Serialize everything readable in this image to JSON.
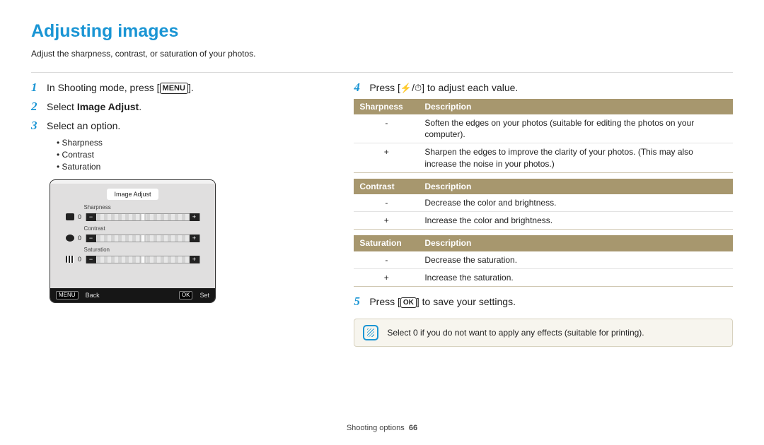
{
  "page": {
    "title": "Adjusting images",
    "subtitle": "Adjust the sharpness, contrast, or saturation of your photos.",
    "footer_section": "Shooting options",
    "footer_page": "66"
  },
  "left": {
    "step1_pre": "In Shooting mode, press [",
    "step1_menu": "MENU",
    "step1_post": "].",
    "step2_pre": "Select ",
    "step2_bold": "Image Adjust",
    "step2_post": ".",
    "step3": "Select an option.",
    "bullets": [
      "Sharpness",
      "Contrast",
      "Saturation"
    ]
  },
  "camera": {
    "screen_title": "Image Adjust",
    "rows": [
      {
        "label": "Sharpness",
        "value": "0"
      },
      {
        "label": "Contrast",
        "value": "0"
      },
      {
        "label": "Saturation",
        "value": "0"
      }
    ],
    "back_badge": "MENU",
    "back_label": "Back",
    "ok_badge": "OK",
    "ok_label": "Set"
  },
  "right": {
    "step4_pre": "Press [",
    "step4_sep": "/",
    "step4_post": "] to adjust each value.",
    "step5_pre": "Press [",
    "step5_ok": "OK",
    "step5_post": "] to save your settings."
  },
  "tables": {
    "sharpness": {
      "h1": "Sharpness",
      "h2": "Description",
      "rows": [
        {
          "sign": "-",
          "desc": "Soften the edges on your photos (suitable for editing the photos on your computer)."
        },
        {
          "sign": "+",
          "desc": "Sharpen the edges to improve the clarity of your photos. (This may also increase the noise in your photos.)"
        }
      ]
    },
    "contrast": {
      "h1": "Contrast",
      "h2": "Description",
      "rows": [
        {
          "sign": "-",
          "desc": "Decrease the color and brightness."
        },
        {
          "sign": "+",
          "desc": "Increase the color and brightness."
        }
      ]
    },
    "saturation": {
      "h1": "Saturation",
      "h2": "Description",
      "rows": [
        {
          "sign": "-",
          "desc": "Decrease the saturation."
        },
        {
          "sign": "+",
          "desc": "Increase the saturation."
        }
      ]
    }
  },
  "note": "Select 0 if you do not want to apply any effects (suitable for printing)."
}
